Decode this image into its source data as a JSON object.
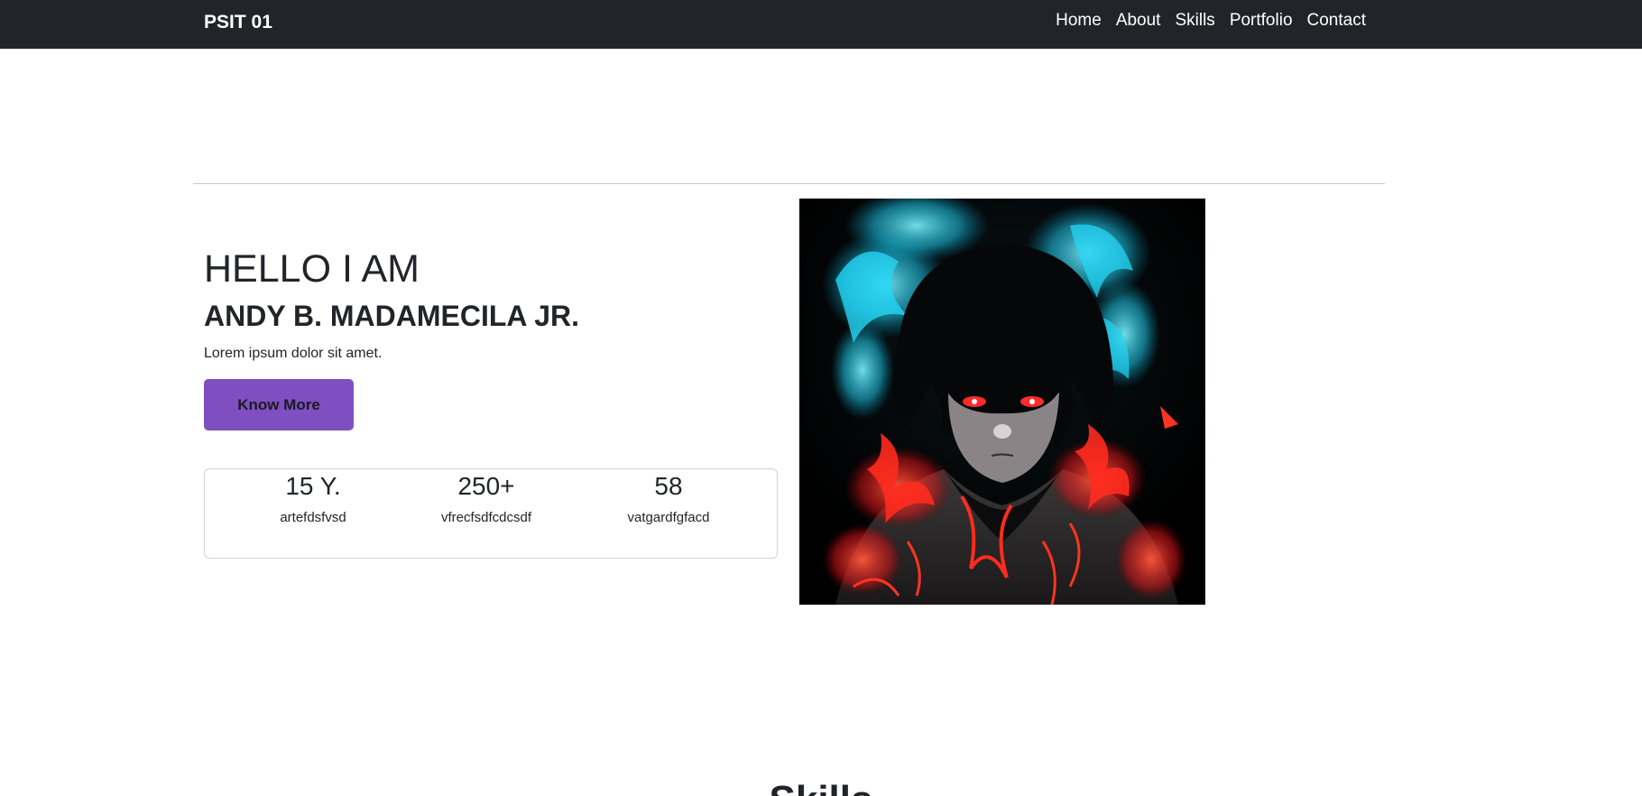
{
  "navbar": {
    "brand": "PSIT 01",
    "links": [
      "Home",
      "About",
      "Skills",
      "Portfolio",
      "Contact"
    ]
  },
  "hero": {
    "greeting": "HELLO I AM",
    "name": "ANDY B. MADAMECILA JR.",
    "tagline": "Lorem ipsum dolor sit amet.",
    "button_label": "Know More",
    "stats": [
      {
        "value": "15 Y.",
        "label": "artefdsfvsd"
      },
      {
        "value": "250+",
        "label": "vfrecfsdfcdcsdf"
      },
      {
        "value": "58",
        "label": "vatgardfgfacd"
      }
    ]
  },
  "next_section": {
    "heading": "Skills"
  },
  "colors": {
    "navbar_bg": "#212529",
    "button_bg": "#7f4fc2",
    "text": "#212529"
  }
}
